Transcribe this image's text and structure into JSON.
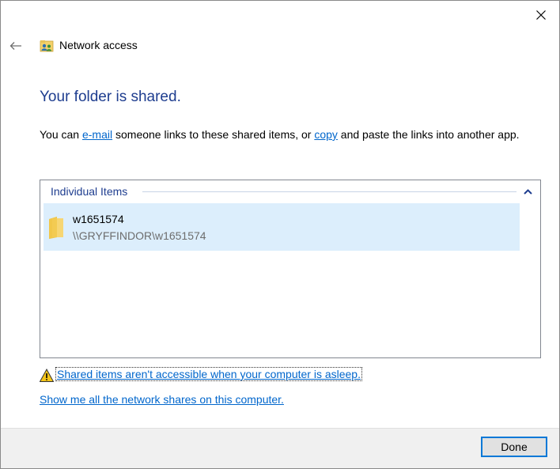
{
  "window": {
    "title": "Network access",
    "close_icon": "close-icon",
    "back_icon": "back-arrow-icon"
  },
  "main": {
    "heading": "Your folder is shared.",
    "description": {
      "part1": "You can ",
      "email_link": "e-mail",
      "part2": " someone links to these shared items, or ",
      "copy_link": "copy",
      "part3": " and paste the links into another app."
    }
  },
  "items_group": {
    "header": "Individual Items",
    "collapse_icon": "chevron-up-icon",
    "items": [
      {
        "name": "w1651574",
        "path": "\\\\GRYFFINDOR\\w1651574",
        "icon": "folder-icon"
      }
    ]
  },
  "warning": {
    "icon": "warning-icon",
    "text": "Shared items aren't accessible when your computer is asleep."
  },
  "shares_link": "Show me all the network shares on this computer.",
  "footer": {
    "done_label": "Done"
  },
  "colors": {
    "heading": "#1e3d8f",
    "link": "#0066cc",
    "selection": "#dceefc",
    "accent": "#0078d7"
  }
}
